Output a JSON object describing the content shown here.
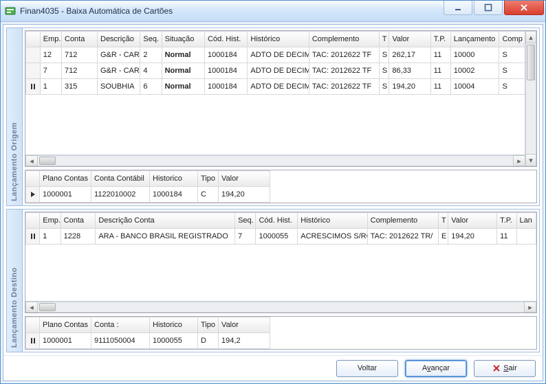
{
  "window": {
    "title": "Finan4035 - Baixa Automática de Cartões"
  },
  "buttons": {
    "back": "Voltar",
    "next_prefix": "A",
    "next_underlined": "v",
    "next_suffix": "ançar",
    "exit_prefix": "",
    "exit_underlined": "S",
    "exit_suffix": "air"
  },
  "origem": {
    "side_label": "Lançamento Origem",
    "headers": {
      "emp": "Emp.",
      "conta": "Conta",
      "descricao": "Descrição",
      "seq": "Seq.",
      "situacao": "Situação",
      "codhist": "Cód. Hist.",
      "historico": "Histórico",
      "complemento": "Complemento",
      "t": "T",
      "valor": "Valor",
      "tp": "T.P.",
      "lancamento": "Lançamento",
      "comp": "Comp"
    },
    "rows": [
      {
        "emp": "12",
        "conta": "712",
        "descricao": "G&R - CAR",
        "seq": "2",
        "situacao": "Normal",
        "codhist": "1000184",
        "historico": "ADTO DE DECIM",
        "complemento": "TAC: 2012622  TF",
        "t": "S",
        "valor": "262,17",
        "tp": "11",
        "lancamento": "10000",
        "comp": "S"
      },
      {
        "emp": "7",
        "conta": "712",
        "descricao": "G&R - CAR",
        "seq": "4",
        "situacao": "Normal",
        "codhist": "1000184",
        "historico": "ADTO DE DECIM",
        "complemento": "TAC: 2012622  TF",
        "t": "S",
        "valor": "86,33",
        "tp": "11",
        "lancamento": "10002",
        "comp": "S"
      },
      {
        "emp": "1",
        "conta": "315",
        "descricao": "SOUBHIA",
        "seq": "6",
        "situacao": "Normal",
        "codhist": "1000184",
        "historico": "ADTO DE DECIM",
        "complemento": "TAC: 2012622  TF",
        "t": "S",
        "valor": "194,20",
        "tp": "11",
        "lancamento": "10004",
        "comp": "S"
      }
    ],
    "detail": {
      "headers": {
        "plano": "Plano Contas",
        "conta": "Conta Contábil",
        "historico": "Historico",
        "tipo": "Tipo",
        "valor": "Valor"
      },
      "row": {
        "plano": "1000001",
        "conta": "1122010002",
        "historico": "1000184",
        "tipo": "C",
        "valor": "194,20"
      }
    }
  },
  "destino": {
    "side_label": "Lançamento Destino",
    "headers": {
      "emp": "Emp.",
      "conta": "Conta",
      "descricao": "Descrição Conta",
      "seq": "Seq.",
      "codhist": "Cód. Hist.",
      "historico": "Histórico",
      "complemento": "Complemento",
      "t": "T",
      "valor": "Valor",
      "tp": "T.P.",
      "lan": "Lan"
    },
    "rows": [
      {
        "emp": "1",
        "conta": "1228",
        "descricao": "ARA - BANCO BRASIL REGISTRADO",
        "seq": "7",
        "codhist": "1000055",
        "historico": "ACRESCIMOS S/RC",
        "complemento": "TAC: 2012622  TR/",
        "t": "E",
        "valor": "194,20",
        "tp": "11"
      }
    ],
    "detail": {
      "headers": {
        "plano": "Plano Contas",
        "conta": "Conta :",
        "historico": "Historico",
        "tipo": "Tipo",
        "valor": "Valor"
      },
      "row": {
        "plano": "1000001",
        "conta": "9111050004",
        "historico": "1000055",
        "tipo": "D",
        "valor": "194,2"
      }
    }
  }
}
